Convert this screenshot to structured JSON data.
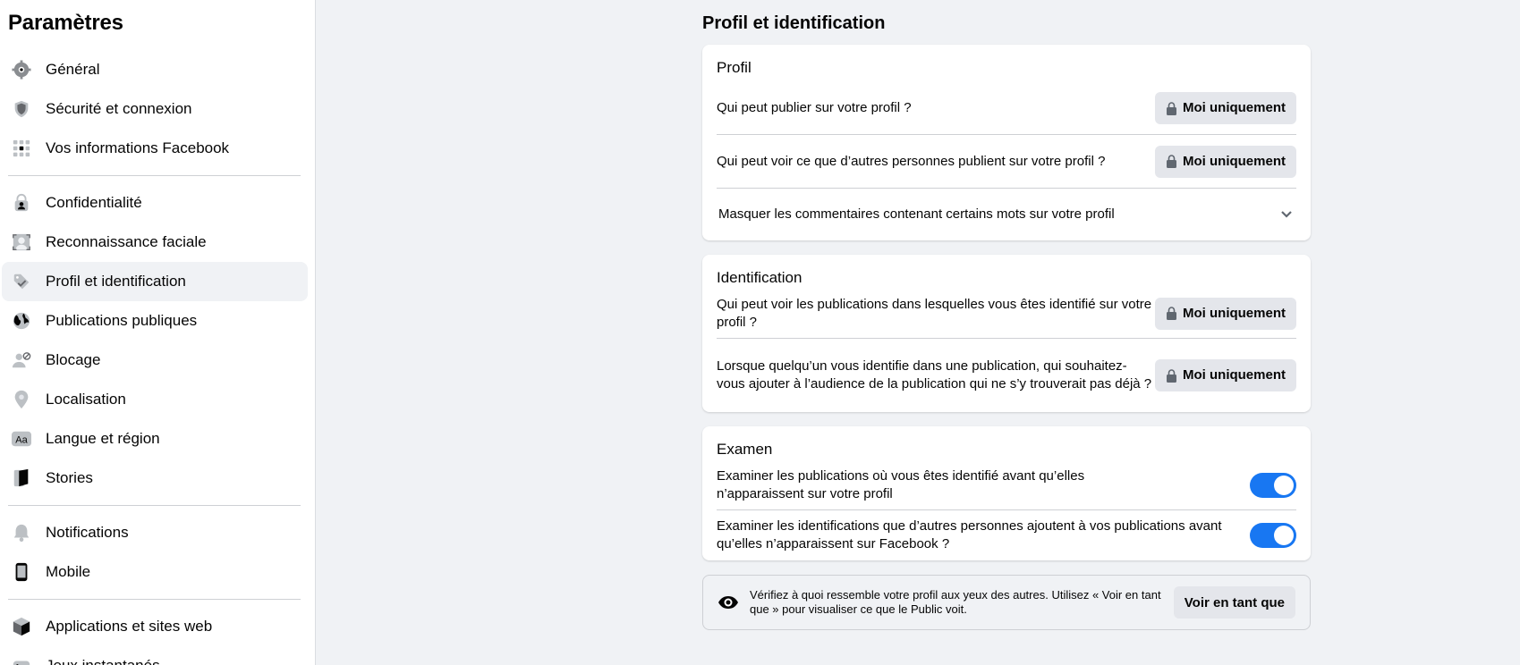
{
  "sidebar": {
    "title": "Paramètres",
    "items": [
      {
        "label": "Général",
        "icon": "gear-icon"
      },
      {
        "label": "Sécurité et connexion",
        "icon": "shield-icon"
      },
      {
        "label": "Vos informations Facebook",
        "icon": "grid-icon"
      },
      {
        "label": "Confidentialité",
        "icon": "lock-person-icon"
      },
      {
        "label": "Reconnaissance faciale",
        "icon": "face-recognition-icon"
      },
      {
        "label": "Profil et identification",
        "icon": "tag-icon"
      },
      {
        "label": "Publications publiques",
        "icon": "globe-icon"
      },
      {
        "label": "Blocage",
        "icon": "block-user-icon"
      },
      {
        "label": "Localisation",
        "icon": "location-pin-icon"
      },
      {
        "label": "Langue et région",
        "icon": "language-icon"
      },
      {
        "label": "Stories",
        "icon": "book-icon"
      },
      {
        "label": "Notifications",
        "icon": "bell-icon"
      },
      {
        "label": "Mobile",
        "icon": "phone-icon"
      },
      {
        "label": "Applications et sites web",
        "icon": "cube-icon"
      },
      {
        "label": "Jeux instantanés",
        "icon": "game-icon"
      }
    ]
  },
  "main": {
    "title": "Profil et identification",
    "profil": {
      "title": "Profil",
      "rows": [
        {
          "text": "Qui peut publier sur votre profil ?",
          "button": "Moi uniquement"
        },
        {
          "text": "Qui peut voir ce que d’autres personnes publient sur votre profil ?",
          "button": "Moi uniquement"
        }
      ],
      "collapsible": "Masquer les commentaires contenant certains mots sur votre profil"
    },
    "identification": {
      "title": "Identification",
      "rows": [
        {
          "text": "Qui peut voir les publications dans lesquelles vous êtes identifié sur votre profil ?",
          "button": "Moi uniquement"
        },
        {
          "text": "Lorsque quelqu’un vous identifie dans une publication, qui souhaitez-vous ajouter à l’audience de la publication qui ne s’y trouverait pas déjà ?",
          "button": "Moi uniquement"
        }
      ]
    },
    "examen": {
      "title": "Examen",
      "rows": [
        {
          "text": "Examiner les publications où vous êtes identifié avant qu’elles n’apparaissent sur votre profil",
          "enabled": true
        },
        {
          "text": "Examiner les identifications que d’autres personnes ajoutent à vos publications avant qu’elles n’apparaissent sur Facebook ?",
          "enabled": true
        }
      ]
    },
    "view_as": {
      "text": "Vérifiez à quoi ressemble votre profil aux yeux des autres. Utilisez « Voir en tant que » pour visualiser ce que le Public voit.",
      "button": "Voir en tant que"
    }
  },
  "colors": {
    "accent": "#1877f2",
    "button_bg": "#e4e6eb",
    "page_bg": "#f0f2f5"
  }
}
